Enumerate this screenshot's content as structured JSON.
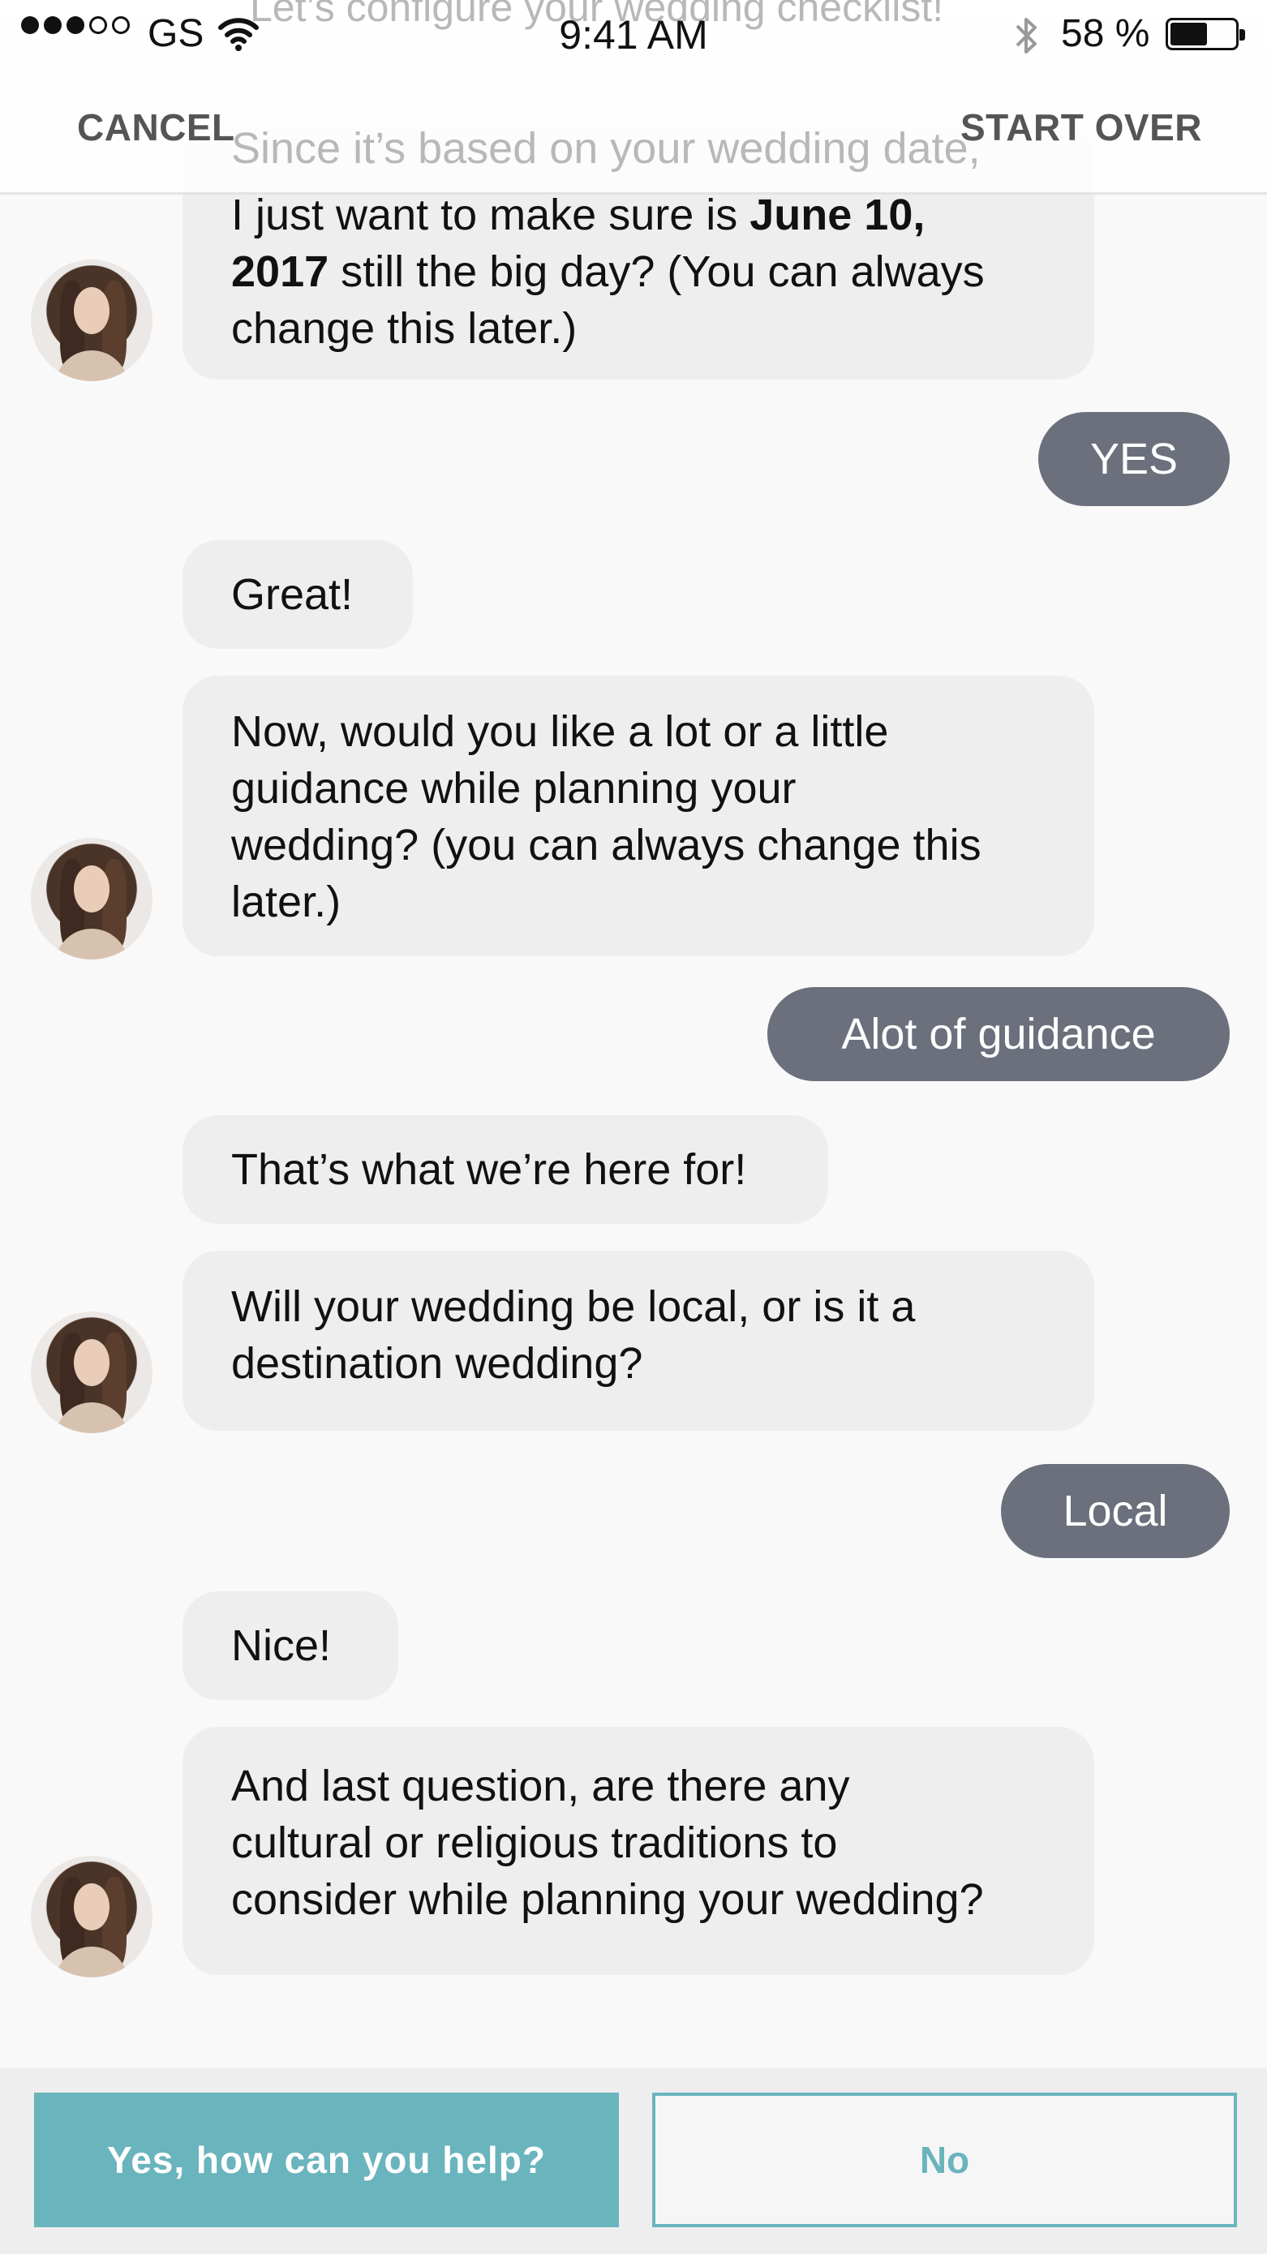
{
  "status_bar": {
    "carrier": "GS",
    "time": "9:41 AM",
    "battery_percent_text": "58 %",
    "battery_level": 0.58,
    "signal_bars_filled": 3,
    "signal_bars_total": 5
  },
  "nav": {
    "cancel_label": "CANCEL",
    "start_over_label": "START OVER",
    "faded_title": "Let’s configure your wedding checklist!"
  },
  "chat": {
    "bot_msg_1": {
      "faded_line": "Since it’s based on your wedding date,",
      "line_1_pre": "I just want to make sure is ",
      "line_1_bold": "June 10,",
      "line_2_bold": "2017",
      "line_2_post": " still the big day? (You can always",
      "line_3": "change this later.)"
    },
    "user_reply_1": "YES",
    "bot_msg_2": "Great!",
    "bot_msg_3": {
      "line_1": "Now, would you like a lot or a little",
      "line_2": "guidance while planning your",
      "line_3": "wedding? (you can always change this",
      "line_4": "later.)"
    },
    "user_reply_2": "Alot of guidance",
    "bot_msg_4": "That’s what we’re here for!",
    "bot_msg_5": {
      "line_1": "Will your wedding be local, or is it a",
      "line_2": "destination wedding?"
    },
    "user_reply_3": "Local",
    "bot_msg_6": "Nice!",
    "bot_msg_7": {
      "line_1": "And last question, are there any",
      "line_2": "cultural or religious traditions to",
      "line_3": "consider while planning your wedding?"
    }
  },
  "footer": {
    "yes_label": "Yes, how can you help?",
    "no_label": "No"
  },
  "colors": {
    "accent": "#6ab4bd",
    "user_bubble": "#6b707c",
    "bot_bubble": "#efeeee"
  }
}
